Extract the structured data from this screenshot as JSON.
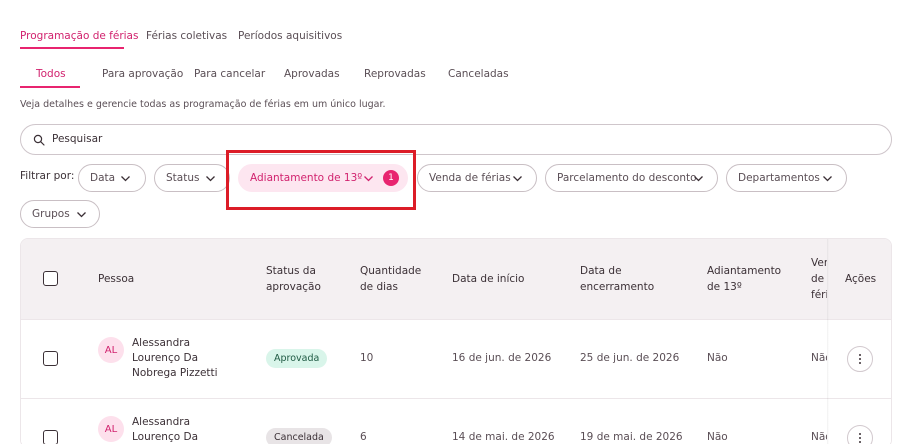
{
  "top_tabs": [
    {
      "label": "Programação de férias",
      "active": true
    },
    {
      "label": "Férias coletivas",
      "active": false
    },
    {
      "label": "Períodos aquisitivos",
      "active": false
    }
  ],
  "sub_tabs": [
    {
      "label": "Todos",
      "active": true
    },
    {
      "label": "Para aprovação",
      "active": false
    },
    {
      "label": "Para cancelar",
      "active": false
    },
    {
      "label": "Aprovadas",
      "active": false
    },
    {
      "label": "Reprovadas",
      "active": false
    },
    {
      "label": "Canceladas",
      "active": false
    }
  ],
  "description": "Veja detalhes e gerencie todas as programação de férias em um único lugar.",
  "search": {
    "placeholder": "Pesquisar",
    "icon": "search-icon"
  },
  "filters": {
    "label": "Filtrar por:",
    "chips": [
      {
        "label": "Data",
        "active": false
      },
      {
        "label": "Status",
        "active": false
      },
      {
        "label": "Adiantamento de 13º",
        "active": true,
        "count": "1"
      },
      {
        "label": "Venda de férias",
        "active": false
      },
      {
        "label": "Parcelamento do desconto",
        "active": false
      },
      {
        "label": "Departamentos",
        "active": false
      },
      {
        "label": "Grupos",
        "active": false
      }
    ]
  },
  "table": {
    "headers": {
      "pessoa": "Pessoa",
      "status": "Status da aprovação",
      "quantidade": "Quantidade de dias",
      "inicio": "Data de início",
      "encerramento": "Data de encerramento",
      "adiantamento": "Adiantamento de 13º",
      "venda": "Venda de férias",
      "acoes": "Ações"
    },
    "rows": [
      {
        "initials": "AL",
        "name": "Alessandra Lourenço Da Nobrega Pizzetti",
        "status": "Aprovada",
        "status_kind": "approved",
        "days": "10",
        "start": "16 de jun. de 2026",
        "end": "25 de jun. de 2026",
        "advance": "Não",
        "sale": "Não"
      },
      {
        "initials": "AL",
        "name": "Alessandra Lourenço Da Nobrega Pizzetti",
        "status": "Cancelada",
        "status_kind": "cancelled",
        "days": "6",
        "start": "14 de mai. de 2026",
        "end": "19 de mai. de 2026",
        "advance": "Não",
        "sale": "Não"
      }
    ]
  },
  "colors": {
    "accent": "#e8246f",
    "accent_soft": "#fde6f0",
    "highlight_box": "#dc1c27",
    "approved_bg": "#d9f5ea",
    "cancelled_bg": "#e8e4e6"
  }
}
